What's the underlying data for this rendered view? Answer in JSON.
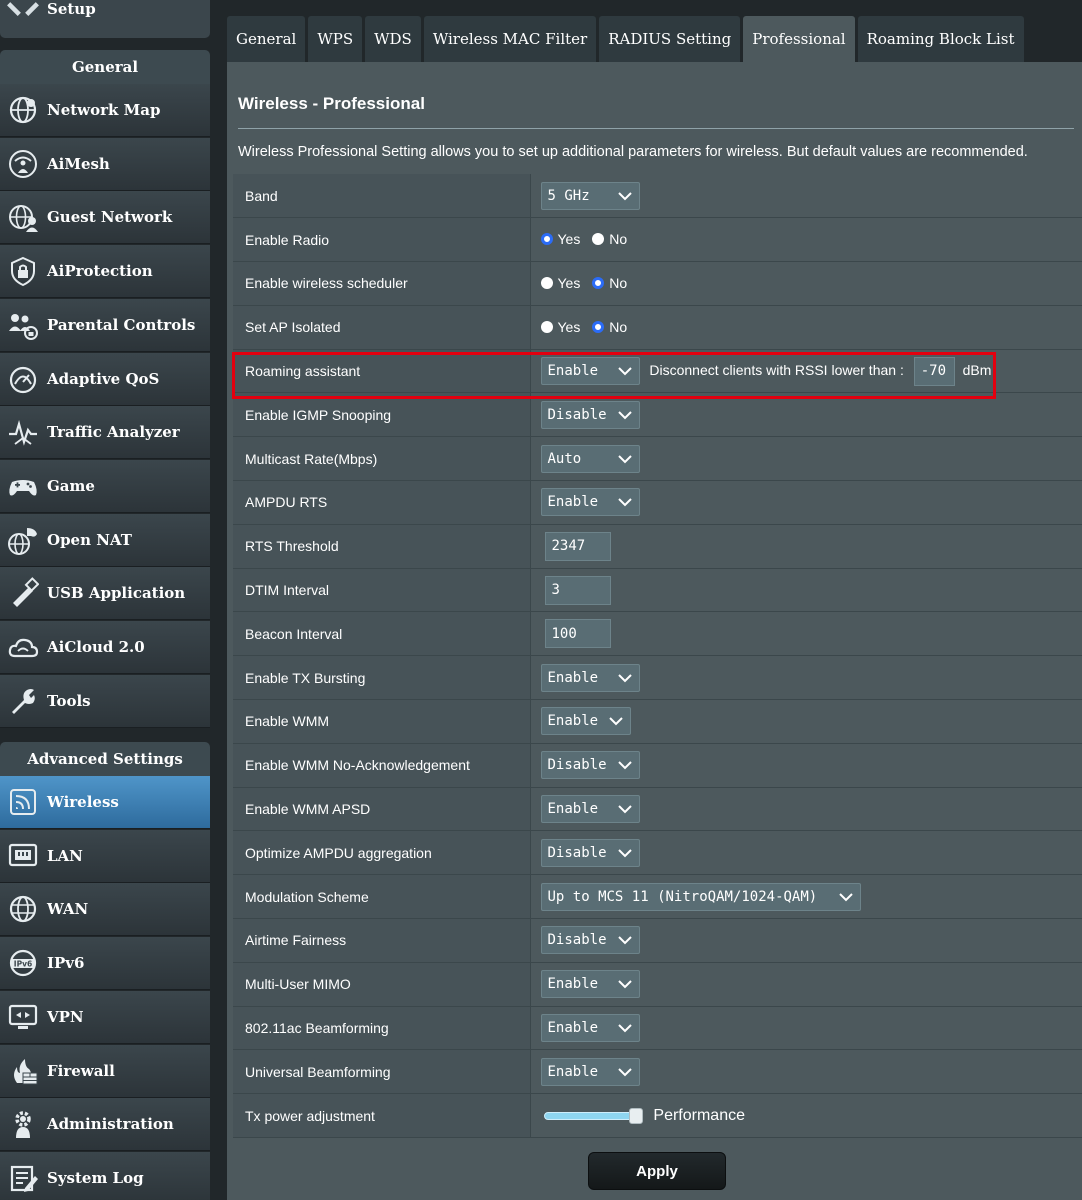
{
  "sidebar": {
    "setup_label": "Setup",
    "general_header": "General",
    "general_items": [
      {
        "label": "Network Map",
        "icon": "globe-icon"
      },
      {
        "label": "AiMesh",
        "icon": "wifi-person-icon"
      },
      {
        "label": "Guest Network",
        "icon": "guest-globe-icon"
      },
      {
        "label": "AiProtection",
        "icon": "shield-lock-icon"
      },
      {
        "label": "Parental Controls",
        "icon": "family-icon"
      },
      {
        "label": "Adaptive QoS",
        "icon": "speedometer-icon"
      },
      {
        "label": "Traffic Analyzer",
        "icon": "pulse-icon"
      },
      {
        "label": "Game",
        "icon": "gamepad-icon"
      },
      {
        "label": "Open NAT",
        "icon": "open-nat-icon"
      },
      {
        "label": "USB Application",
        "icon": "usb-icon"
      },
      {
        "label": "AiCloud 2.0",
        "icon": "cloud-icon"
      },
      {
        "label": "Tools",
        "icon": "wrench-icon"
      }
    ],
    "advanced_header": "Advanced Settings",
    "advanced_items": [
      {
        "label": "Wireless",
        "icon": "wireless-icon",
        "active": true
      },
      {
        "label": "LAN",
        "icon": "lan-icon"
      },
      {
        "label": "WAN",
        "icon": "wan-globe-icon"
      },
      {
        "label": "IPv6",
        "icon": "ipv6-icon"
      },
      {
        "label": "VPN",
        "icon": "vpn-icon"
      },
      {
        "label": "Firewall",
        "icon": "firewall-icon"
      },
      {
        "label": "Administration",
        "icon": "admin-gear-icon"
      },
      {
        "label": "System Log",
        "icon": "system-log-icon"
      }
    ]
  },
  "tabs": [
    "General",
    "WPS",
    "WDS",
    "Wireless MAC Filter",
    "RADIUS Setting",
    "Professional",
    "Roaming Block List"
  ],
  "active_tab": "Professional",
  "page": {
    "title": "Wireless - Professional",
    "description": "Wireless Professional Setting allows you to set up additional parameters for wireless. But default values are recommended."
  },
  "settings": {
    "band": {
      "label": "Band",
      "value": "5 GHz"
    },
    "enable_radio": {
      "label": "Enable Radio",
      "yes": "Yes",
      "no": "No",
      "selected": "yes"
    },
    "wireless_scheduler": {
      "label": "Enable wireless scheduler",
      "yes": "Yes",
      "no": "No",
      "selected": "no"
    },
    "ap_isolated": {
      "label": "Set AP Isolated",
      "yes": "Yes",
      "no": "No",
      "selected": "no"
    },
    "roaming_assistant": {
      "label": "Roaming assistant",
      "value": "Enable",
      "rssi_text": "Disconnect clients with RSSI lower than :",
      "rssi_value": "-70",
      "rssi_unit": "dBm"
    },
    "igmp_snooping": {
      "label": "Enable IGMP Snooping",
      "value": "Disable"
    },
    "multicast_rate": {
      "label": "Multicast Rate(Mbps)",
      "value": "Auto"
    },
    "ampdu_rts": {
      "label": "AMPDU RTS",
      "value": "Enable"
    },
    "rts_threshold": {
      "label": "RTS Threshold",
      "value": "2347"
    },
    "dtim_interval": {
      "label": "DTIM Interval",
      "value": "3"
    },
    "beacon_interval": {
      "label": "Beacon Interval",
      "value": "100"
    },
    "tx_bursting": {
      "label": "Enable TX Bursting",
      "value": "Enable"
    },
    "wmm": {
      "label": "Enable WMM",
      "value": "Enable"
    },
    "wmm_no_ack": {
      "label": "Enable WMM No-Acknowledgement",
      "value": "Disable"
    },
    "wmm_apsd": {
      "label": "Enable WMM APSD",
      "value": "Enable"
    },
    "ampdu_aggregation": {
      "label": "Optimize AMPDU aggregation",
      "value": "Disable"
    },
    "modulation": {
      "label": "Modulation Scheme",
      "value": "Up to MCS 11 (NitroQAM/1024-QAM)"
    },
    "airtime_fairness": {
      "label": "Airtime Fairness",
      "value": "Disable"
    },
    "mu_mimo": {
      "label": "Multi-User MIMO",
      "value": "Enable"
    },
    "beamforming_11ac": {
      "label": "802.11ac Beamforming",
      "value": "Enable"
    },
    "universal_beamforming": {
      "label": "Universal Beamforming",
      "value": "Enable"
    },
    "tx_power": {
      "label": "Tx power adjustment",
      "value_label": "Performance",
      "level": 1.0
    }
  },
  "apply_label": "Apply",
  "colors": {
    "highlight": "#e3000f",
    "radio_selected": "#2b6cf7",
    "active_nav": "#3e82b6"
  }
}
